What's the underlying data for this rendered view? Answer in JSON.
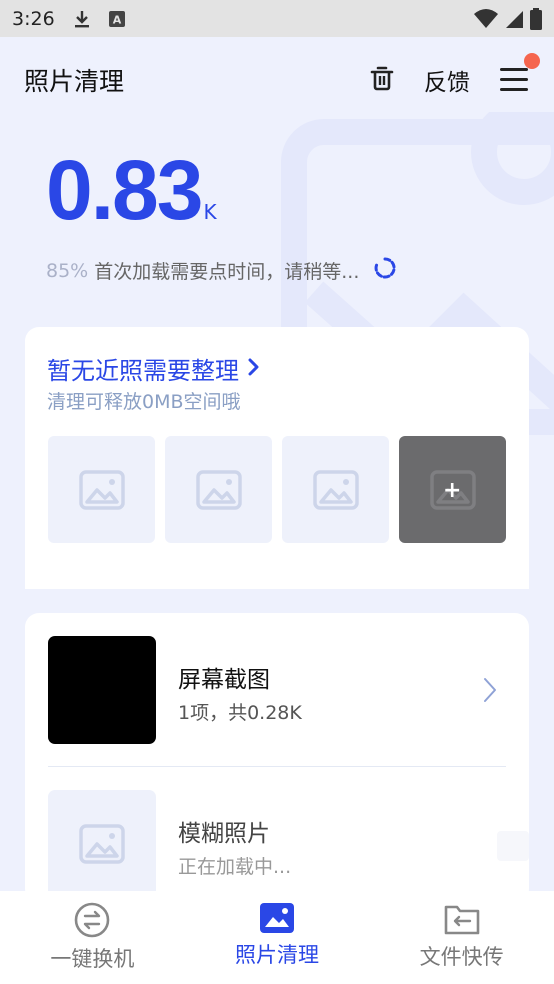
{
  "status_bar": {
    "time": "3:26",
    "icons": [
      "download-icon",
      "a-icon",
      "wifi-icon",
      "signal-icon",
      "battery-icon"
    ]
  },
  "header": {
    "title": "照片清理",
    "feedback_label": "反馈",
    "icons": [
      "trash-icon",
      "menu-icon"
    ],
    "has_notification_dot": true
  },
  "summary": {
    "size_value": "0.83",
    "size_unit": "K",
    "progress_percent": "85%",
    "progress_text": "首次加载需要点时间，请稍等..."
  },
  "recent_card": {
    "title": "暂无近照需要整理",
    "subtitle": "清理可释放0MB空间哦",
    "thumbnails": [
      "image-placeholder-icon",
      "image-placeholder-icon",
      "image-placeholder-icon",
      "add-image-icon"
    ]
  },
  "categories": [
    {
      "title": "屏幕截图",
      "subtitle": "1项，共0.28K"
    },
    {
      "title": "模糊照片",
      "subtitle": "正在加载中..."
    }
  ],
  "bottom_nav": [
    {
      "label": "一键换机",
      "icon": "swap-icon",
      "active": false
    },
    {
      "label": "照片清理",
      "icon": "photo-icon",
      "active": true
    },
    {
      "label": "文件快传",
      "icon": "folder-transfer-icon",
      "active": false
    }
  ],
  "colors": {
    "accent": "#2a47e6",
    "background": "#eef1fd",
    "notification": "#f5654e"
  }
}
